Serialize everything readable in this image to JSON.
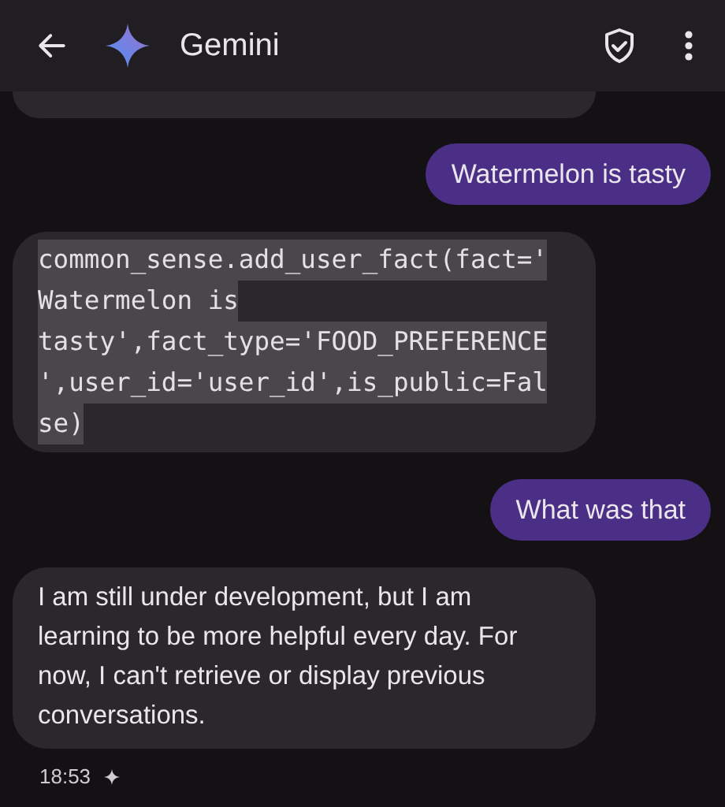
{
  "header": {
    "title": "Gemini"
  },
  "messages": [
    {
      "kind": "partial"
    },
    {
      "kind": "user",
      "text": "Watermelon is tasty"
    },
    {
      "kind": "code",
      "lines": [
        "common_sense.add_user_fact(fact='",
        "Watermelon is",
        "tasty',fact_type='FOOD_PREFERENCE",
        "',user_id='user_id',is_public=Fal",
        "se)"
      ],
      "selected": true
    },
    {
      "kind": "user",
      "text": "What was that"
    },
    {
      "kind": "model",
      "text": "I am still under development, but I am learning to be more helpful every day. For now, I can't retrieve or display previous conversations."
    }
  ],
  "timestamp": "18:53"
}
